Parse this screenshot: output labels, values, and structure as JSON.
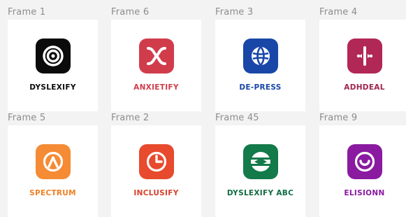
{
  "frames": [
    {
      "label": "Frame 1",
      "brand": "DYSLEXIFY",
      "icon": "concentric-circles-icon",
      "color": "#0b0b0b",
      "text_color": "#0b0b0b"
    },
    {
      "label": "Frame 6",
      "brand": "ANXIETIFY",
      "icon": "x-wave-icon",
      "color": "#d13c4b",
      "text_color": "#d13c4b"
    },
    {
      "label": "Frame 3",
      "brand": "DE-PRESS",
      "icon": "globe-ball-icon",
      "color": "#1947a8",
      "text_color": "#1947a8"
    },
    {
      "label": "Frame 4",
      "brand": "ADHDEAL",
      "icon": "split-star-icon",
      "color": "#b12756",
      "text_color": "#a02450"
    },
    {
      "label": "Frame 5",
      "brand": "SPECTRUM",
      "icon": "triangle-circle-icon",
      "color": "#f58b34",
      "text_color": "#f07f22"
    },
    {
      "label": "Frame 2",
      "brand": "INCLUSIFY",
      "icon": "pie-circle-icon",
      "color": "#e84a2d",
      "text_color": "#d8412a"
    },
    {
      "label": "Frame 45",
      "brand": "DYSLEXIFY ABC",
      "icon": "striped-sphere-icon",
      "color": "#137a4a",
      "text_color": "#116b42"
    },
    {
      "label": "Frame 9",
      "brand": "ELISIONN",
      "icon": "smile-circle-icon",
      "color": "#8a1aa0",
      "text_color": "#8a1aa0"
    }
  ]
}
